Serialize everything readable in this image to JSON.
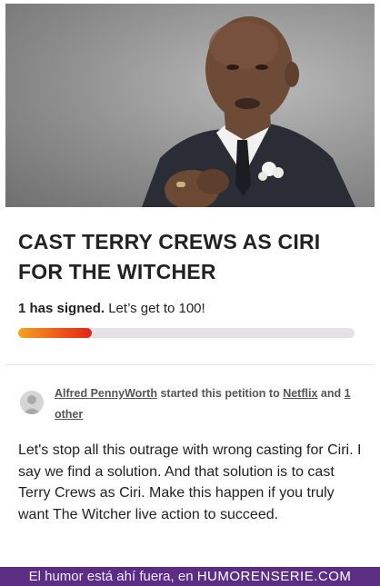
{
  "petition": {
    "image_alt": "Man in suit with boutonniere",
    "title": "CAST TERRY CREWS AS CIRI FOR THE WITCHER",
    "signed_count": "1 has signed.",
    "signed_goal": "Let’s get to 100!",
    "progress_fraction": 0.22,
    "progress_colors": [
      "#f4a21c",
      "#ef5a1b",
      "#e3231a"
    ],
    "starter": {
      "name": "Alfred PennyWorth",
      "action": "started this petition to",
      "target": "Netflix",
      "conjunction": "and",
      "others_count": "1",
      "others_word": "other"
    },
    "body": "Let's stop all this outrage with wrong casting for Ciri. I say we find a solution. And that solution is to cast Terry Crews as Ciri. Make this happen if you truly want The Witcher live action to succeed."
  },
  "watermark": {
    "text": "El humor está ahí fuera, en",
    "brand": "HUMORENSERIE.COM",
    "color": "#5b2d83"
  },
  "icons": {
    "avatar": "user-avatar-icon"
  }
}
